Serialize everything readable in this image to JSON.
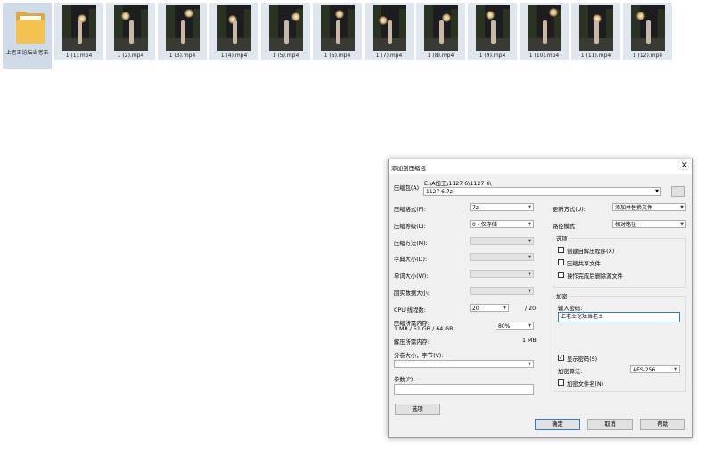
{
  "files": [
    {
      "name": "上老王论坛当老王",
      "type": "folder"
    },
    {
      "name": "1 (1).mp4",
      "type": "video"
    },
    {
      "name": "1 (2).mp4",
      "type": "video"
    },
    {
      "name": "1 (3).mp4",
      "type": "video"
    },
    {
      "name": "1 (4).mp4",
      "type": "video"
    },
    {
      "name": "1 (5).mp4",
      "type": "video"
    },
    {
      "name": "1 (6).mp4",
      "type": "video"
    },
    {
      "name": "1 (7).mp4",
      "type": "video"
    },
    {
      "name": "1 (8).mp4",
      "type": "video"
    },
    {
      "name": "1 (9).mp4",
      "type": "video"
    },
    {
      "name": "1 (10).mp4",
      "type": "video"
    },
    {
      "name": "1 (11).mp4",
      "type": "video"
    },
    {
      "name": "1 (12).mp4",
      "type": "video"
    }
  ],
  "dialog": {
    "title": "添加到压缩包",
    "close": "×",
    "archive_label": "压缩包(A)",
    "archive_path": "E:\\A加工\\1127 6\\1127 6\\",
    "archive_name": "1127 6.7z",
    "browse": "...",
    "format_label": "压缩格式(F):",
    "format_value": "7z",
    "level_label": "压缩等级(L):",
    "level_value": "0 - 仅存储",
    "method_label": "压缩方法(M):",
    "dict_label": "字典大小(D):",
    "word_label": "单词大小(W):",
    "solid_label": "固实数据大小:",
    "cpu_label": "CPU 线程数:",
    "cpu_value": "20",
    "cpu_total": "/ 20",
    "mem_comp_label": "压缩所需内存:",
    "mem_comp_value": "1 MB / 51 GB / 64 GB",
    "mem_pct": "80%",
    "mem_decomp_label": "解压所需内存:",
    "mem_decomp_value": "1 MB",
    "split_label": "分卷大小，字节(V):",
    "params_label": "参数(P):",
    "options_button": "选项",
    "update_label": "更新方式(U):",
    "update_value": "添加并替换文件",
    "path_label": "路径模式",
    "path_value": "相对路径",
    "options_group": "选项",
    "opt_sfx": "创建自解压程序(X)",
    "opt_shared": "压缩共享文件",
    "opt_delete": "操作完成后删除源文件",
    "enc_group": "加密",
    "password_label": "输入密码:",
    "password_value": "上老王论坛当老王",
    "show_password": "显示密码(S)",
    "enc_method_label": "加密算法:",
    "enc_method_value": "AES-256",
    "enc_names": "加密文件名(N)",
    "ok": "确定",
    "cancel": "取消",
    "help": "帮助",
    "check": "✓",
    "arrow": "▼"
  }
}
